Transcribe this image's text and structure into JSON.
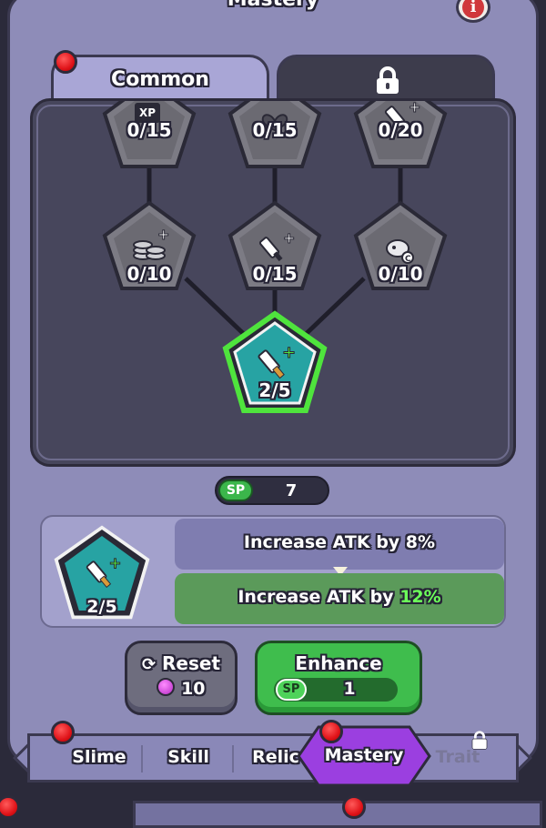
{
  "header": {
    "title": "Mastery"
  },
  "tabs": [
    {
      "label": "Common",
      "active": true
    },
    {
      "label": "",
      "locked": true
    }
  ],
  "tree": {
    "nodes": [
      {
        "id": "xp",
        "icon": "xp-plus-icon",
        "badge": "XP",
        "count": "0/15",
        "locked": true
      },
      {
        "id": "hp",
        "icon": "heart-icon",
        "count": "0/15",
        "locked": true
      },
      {
        "id": "atk3",
        "icon": "sword-plus-icon",
        "count": "0/20",
        "locked": true
      },
      {
        "id": "gold",
        "icon": "coin-stack-plus-icon",
        "count": "0/10",
        "locked": true
      },
      {
        "id": "atk2",
        "icon": "sword-plus-icon",
        "count": "0/15",
        "locked": true
      },
      {
        "id": "slime",
        "icon": "slime-coin-icon",
        "count": "0/10",
        "locked": true
      },
      {
        "id": "atk1",
        "icon": "sword-plus-icon",
        "count": "2/5",
        "locked": false,
        "selected": true
      }
    ]
  },
  "sp": {
    "label": "SP",
    "value": "7"
  },
  "detail": {
    "count": "2/5",
    "current": "Increase ATK by 8%",
    "next_prefix": "Increase ATK by ",
    "next_value": "12%"
  },
  "reset": {
    "label": "Reset",
    "cost": "10",
    "currency_icon": "gem-icon"
  },
  "enhance": {
    "label": "Enhance",
    "sp_label": "SP",
    "cost": "1"
  },
  "nav": {
    "items": [
      {
        "label": "Slime",
        "badge": true
      },
      {
        "label": "Skill",
        "badge": false
      },
      {
        "label": "Relic",
        "badge": false
      },
      {
        "label": "Mastery",
        "badge": true,
        "active": true
      },
      {
        "label": "Trait",
        "badge": false,
        "locked": true
      }
    ]
  },
  "colors": {
    "panel": "#8e8cb8",
    "node_locked": "#6b6a72",
    "node_active": "#27a3a3",
    "node_glow": "#36d92f",
    "enhance": "#3fbd4d",
    "nav_active": "#9b3fe0"
  }
}
